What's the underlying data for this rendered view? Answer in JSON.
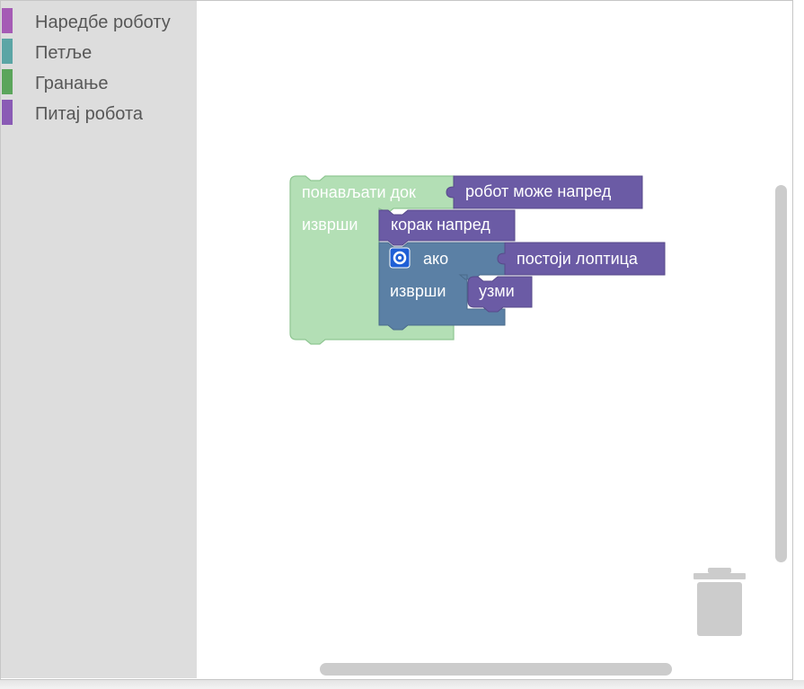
{
  "toolbox": {
    "categories": [
      {
        "label": "Наредбе роботу",
        "color": "#a55bb5"
      },
      {
        "label": "Петље",
        "color": "#5ba5a5"
      },
      {
        "label": "Гранање",
        "color": "#5ba55b"
      },
      {
        "label": "Питај робота",
        "color": "#8a5bb5"
      }
    ]
  },
  "workspace": {
    "repeat_block": {
      "label": "понављати док",
      "do_label": "изврши",
      "color": "#b3dfb5"
    },
    "condition_block": {
      "label": "робот може напред",
      "color": "#6b5ba5"
    },
    "step_block": {
      "label": "корак напред",
      "color": "#6b5ba5"
    },
    "if_block": {
      "label": "ако",
      "do_label": "изврши",
      "color": "#5b80a5",
      "gear_icon": "gear-icon"
    },
    "ball_condition_block": {
      "label": "постоји лоптица",
      "color": "#6b5ba5"
    },
    "take_block": {
      "label": "узми",
      "color": "#6b5ba5"
    }
  },
  "trash": {
    "icon": "trash-icon"
  }
}
